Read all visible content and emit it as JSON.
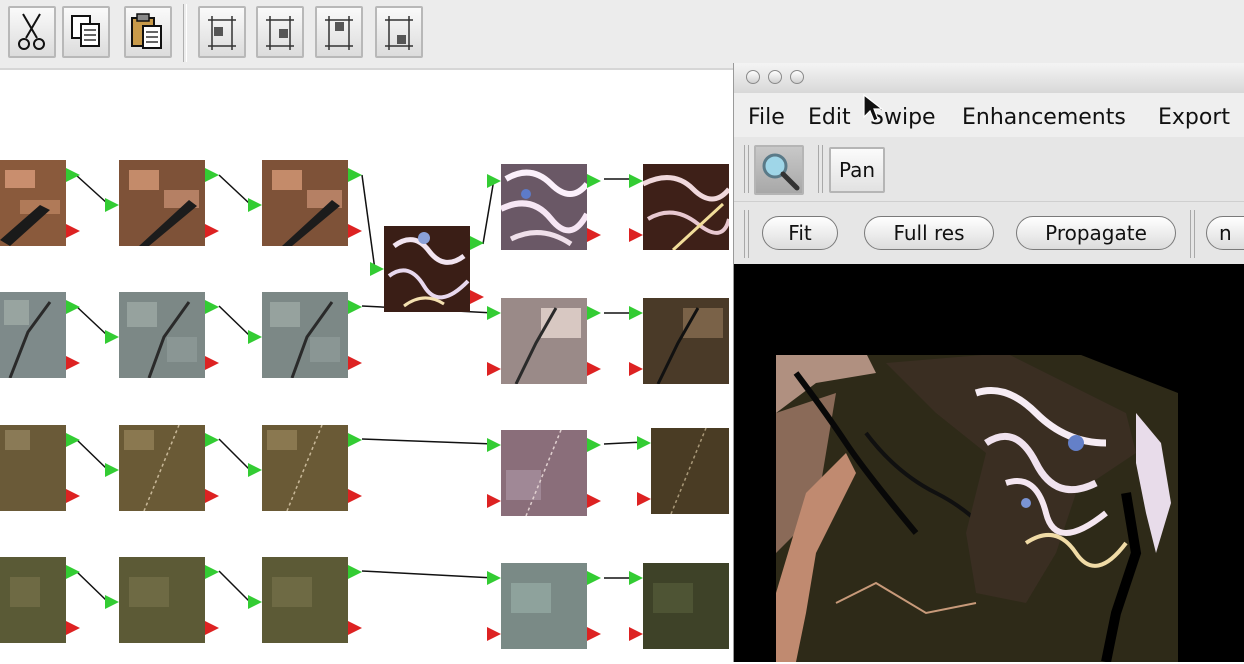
{
  "toolbar": {
    "buttons": [
      {
        "name": "cut-button",
        "icon": "scissors-icon"
      },
      {
        "name": "copy-button",
        "icon": "copy-icon"
      },
      {
        "name": "paste-button",
        "icon": "clipboard-icon"
      },
      {
        "name": "align-top-left-button",
        "icon": "align-top-left-icon"
      },
      {
        "name": "align-top-right-button",
        "icon": "align-top-right-icon"
      },
      {
        "name": "align-bottom-left-button",
        "icon": "align-bottom-left-icon"
      },
      {
        "name": "align-bottom-right-button",
        "icon": "align-bottom-right-icon"
      }
    ]
  },
  "window": {
    "menu": [
      "File",
      "Edit",
      "Swipe",
      "Enhancements",
      "Export"
    ],
    "tools": {
      "zoom_icon": "magnifier-icon",
      "pan_label": "Pan"
    },
    "actions": {
      "fit_label": "Fit",
      "full_res_label": "Full res",
      "propagate_label": "Propagate",
      "cut_off_label": "n"
    }
  },
  "colors": {
    "port_green": "#33cc33",
    "port_red": "#dd2222",
    "viewer_bg": "#000000"
  }
}
